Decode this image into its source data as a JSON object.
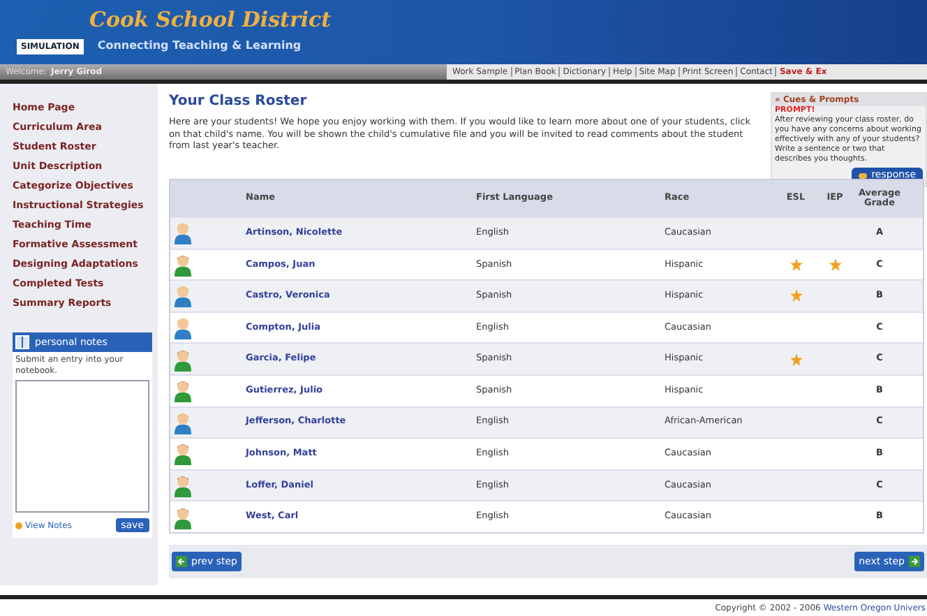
{
  "header": {
    "title": "Cook School District",
    "badge": "SIMULATION",
    "tagline": "Connecting Teaching & Learning"
  },
  "welcome": {
    "label": "Welcome:",
    "user": "Jerry Girod"
  },
  "top_links": [
    {
      "label": "Work Sample",
      "kind": "plain"
    },
    {
      "label": "Plan Book",
      "kind": "plain"
    },
    {
      "label": "Dictionary",
      "kind": "plain"
    },
    {
      "label": "Help",
      "kind": "plain"
    },
    {
      "label": "Site Map",
      "kind": "plain"
    },
    {
      "label": "Print Screen",
      "kind": "plain"
    },
    {
      "label": "Contact",
      "kind": "plain"
    },
    {
      "label": "Save & Ex",
      "kind": "alert"
    }
  ],
  "sidebar": {
    "items": [
      "Home Page",
      "Curriculum Area",
      "Student Roster",
      "Unit Description",
      "Categorize Objectives",
      "Instructional Strategies",
      "Teaching Time",
      "Formative Assessment",
      "Designing Adaptations",
      "Completed Tests",
      "Summary Reports"
    ]
  },
  "notes": {
    "title": "personal notes",
    "hint": "Submit an entry into your notebook.",
    "view": "View Notes",
    "save": "save"
  },
  "page": {
    "title": "Your Class Roster",
    "intro": "Here are your students! We hope you enjoy working with them. If you would like to learn more about one of your students, click on that child's name. You will be shown the child's cumulative file and you will be invited to read comments about the student from last year's teacher."
  },
  "cues": {
    "title": "« Cues & Prompts",
    "prompt": "PROMPT!",
    "text": "After reviewing your class roster, do you have any concerns about working effectively with any of your students? Write a sentence or two that describes you thoughts.",
    "button": "response"
  },
  "table": {
    "columns": [
      "Name",
      "First Language",
      "Race",
      "ESL",
      "IEP",
      "Average Grade"
    ],
    "rows": [
      {
        "kind": "female",
        "name": "Artinson, Nicolette",
        "language": "English",
        "race": "Caucasian",
        "esl": false,
        "iep": false,
        "grade": "A"
      },
      {
        "kind": "male",
        "name": "Campos, Juan",
        "language": "Spanish",
        "race": "Hispanic",
        "esl": true,
        "iep": true,
        "grade": "C"
      },
      {
        "kind": "female",
        "name": "Castro, Veronica",
        "language": "Spanish",
        "race": "Hispanic",
        "esl": true,
        "iep": false,
        "grade": "B"
      },
      {
        "kind": "female",
        "name": "Compton, Julia",
        "language": "English",
        "race": "Caucasian",
        "esl": false,
        "iep": false,
        "grade": "C"
      },
      {
        "kind": "male",
        "name": "Garcia, Felipe",
        "language": "Spanish",
        "race": "Hispanic",
        "esl": true,
        "iep": false,
        "grade": "C"
      },
      {
        "kind": "male",
        "name": "Gutierrez, Julio",
        "language": "Spanish",
        "race": "Hispanic",
        "esl": false,
        "iep": false,
        "grade": "B"
      },
      {
        "kind": "female",
        "name": "Jefferson, Charlotte",
        "language": "English",
        "race": "African-American",
        "esl": false,
        "iep": false,
        "grade": "C"
      },
      {
        "kind": "male",
        "name": "Johnson, Matt",
        "language": "English",
        "race": "Caucasian",
        "esl": false,
        "iep": false,
        "grade": "B"
      },
      {
        "kind": "male",
        "name": "Loffer, Daniel",
        "language": "English",
        "race": "Caucasian",
        "esl": false,
        "iep": false,
        "grade": "C"
      },
      {
        "kind": "male",
        "name": "West, Carl",
        "language": "English",
        "race": "Caucasian",
        "esl": false,
        "iep": false,
        "grade": "B"
      }
    ]
  },
  "nav": {
    "prev": "prev step",
    "next": "next step"
  },
  "footer": {
    "copyright": "Copyright © 2002 - 2006",
    "org": "Western Oregon Univers"
  }
}
